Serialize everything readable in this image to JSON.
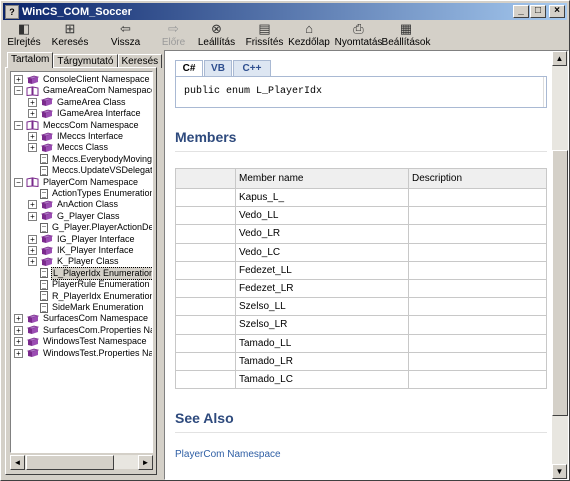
{
  "window": {
    "title": "WinCS_COM_Soccer",
    "minimize": "_",
    "maximize": "□",
    "close": "×"
  },
  "toolbar": {
    "buttons": [
      {
        "label": "Elrejtés",
        "icon": "hide-icon",
        "glyph": "◧",
        "disabled": false
      },
      {
        "label": "Keresés",
        "icon": "locate-icon",
        "glyph": "⊞",
        "disabled": false
      },
      {
        "label": "Vissza",
        "icon": "back-arrow-icon",
        "glyph": "⇦",
        "disabled": false
      },
      {
        "label": "Előre",
        "icon": "forward-arrow-icon",
        "glyph": "⇨",
        "disabled": true
      },
      {
        "label": "Leállítás",
        "icon": "stop-icon",
        "glyph": "⊗",
        "disabled": false
      },
      {
        "label": "Frissítés",
        "icon": "refresh-icon",
        "glyph": "▤",
        "disabled": false
      },
      {
        "label": "Kezdőlap",
        "icon": "home-icon",
        "glyph": "⌂",
        "disabled": false
      },
      {
        "label": "Nyomtatás",
        "icon": "print-icon",
        "glyph": "⎙",
        "disabled": false
      },
      {
        "label": "Beállítások",
        "icon": "options-icon",
        "glyph": "▦",
        "disabled": false
      }
    ]
  },
  "nav_tabs": [
    "Tartalom",
    "Tárgymutató",
    "Keresés"
  ],
  "tree": [
    {
      "label": "ConsoleClient Namespace",
      "level": 0,
      "exp": "+",
      "icon": "book"
    },
    {
      "label": "GameAreaCom Namespace",
      "level": 0,
      "exp": "-",
      "icon": "book-open"
    },
    {
      "label": "GameArea Class",
      "level": 1,
      "exp": "+",
      "icon": "book"
    },
    {
      "label": "IGameArea Interface",
      "level": 1,
      "exp": "+",
      "icon": "book"
    },
    {
      "label": "MeccsCom Namespace",
      "level": 0,
      "exp": "-",
      "icon": "book-open"
    },
    {
      "label": "IMeccs Interface",
      "level": 1,
      "exp": "+",
      "icon": "book"
    },
    {
      "label": "Meccs Class",
      "level": 1,
      "exp": "+",
      "icon": "book"
    },
    {
      "label": "Meccs.EverybodyMovingDe",
      "level": 1,
      "exp": "",
      "icon": "page"
    },
    {
      "label": "Meccs.UpdateVSDelegate D",
      "level": 1,
      "exp": "",
      "icon": "page"
    },
    {
      "label": "PlayerCom Namespace",
      "level": 0,
      "exp": "-",
      "icon": "book-open"
    },
    {
      "label": "ActionTypes Enumeration",
      "level": 1,
      "exp": "",
      "icon": "page"
    },
    {
      "label": "AnAction Class",
      "level": 1,
      "exp": "+",
      "icon": "book"
    },
    {
      "label": "G_Player Class",
      "level": 1,
      "exp": "+",
      "icon": "book"
    },
    {
      "label": "G_Player.PlayerActionDelega",
      "level": 1,
      "exp": "",
      "icon": "page"
    },
    {
      "label": "IG_Player Interface",
      "level": 1,
      "exp": "+",
      "icon": "book"
    },
    {
      "label": "IK_Player Interface",
      "level": 1,
      "exp": "+",
      "icon": "book"
    },
    {
      "label": "K_Player Class",
      "level": 1,
      "exp": "+",
      "icon": "book"
    },
    {
      "label": "L_PlayerIdx Enumeration",
      "level": 1,
      "exp": "",
      "icon": "page",
      "selected": true
    },
    {
      "label": "PlayerRule Enumeration",
      "level": 1,
      "exp": "",
      "icon": "page"
    },
    {
      "label": "R_PlayerIdx Enumeration",
      "level": 1,
      "exp": "",
      "icon": "page"
    },
    {
      "label": "SideMark Enumeration",
      "level": 1,
      "exp": "",
      "icon": "page"
    },
    {
      "label": "SurfacesCom Namespace",
      "level": 0,
      "exp": "+",
      "icon": "book"
    },
    {
      "label": "SurfacesCom.Properties Namesp",
      "level": 0,
      "exp": "+",
      "icon": "book"
    },
    {
      "label": "WindowsTest Namespace",
      "level": 0,
      "exp": "+",
      "icon": "book"
    },
    {
      "label": "WindowsTest.Properties Namesp",
      "level": 0,
      "exp": "+",
      "icon": "book"
    }
  ],
  "content": {
    "code_tabs": [
      "C#",
      "VB",
      "C++"
    ],
    "code": "public enum L_PlayerIdx",
    "members_heading": "Members",
    "columns": [
      "",
      "Member name",
      "Description"
    ],
    "members": [
      "Kapus_L_",
      "Vedo_LL",
      "Vedo_LR",
      "Vedo_LC",
      "Fedezet_LL",
      "Fedezet_LR",
      "Szelso_LL",
      "Szelso_LR",
      "Tamado_LL",
      "Tamado_LR",
      "Tamado_LC"
    ],
    "see_also_heading": "See Also",
    "see_also_link": "PlayerCom Namespace"
  },
  "colors": {
    "title_start": "#0a246a",
    "title_end": "#a6caf0",
    "heading": "#2e4a7d",
    "link": "#2f5fa5",
    "book": "#7a2a8c"
  }
}
